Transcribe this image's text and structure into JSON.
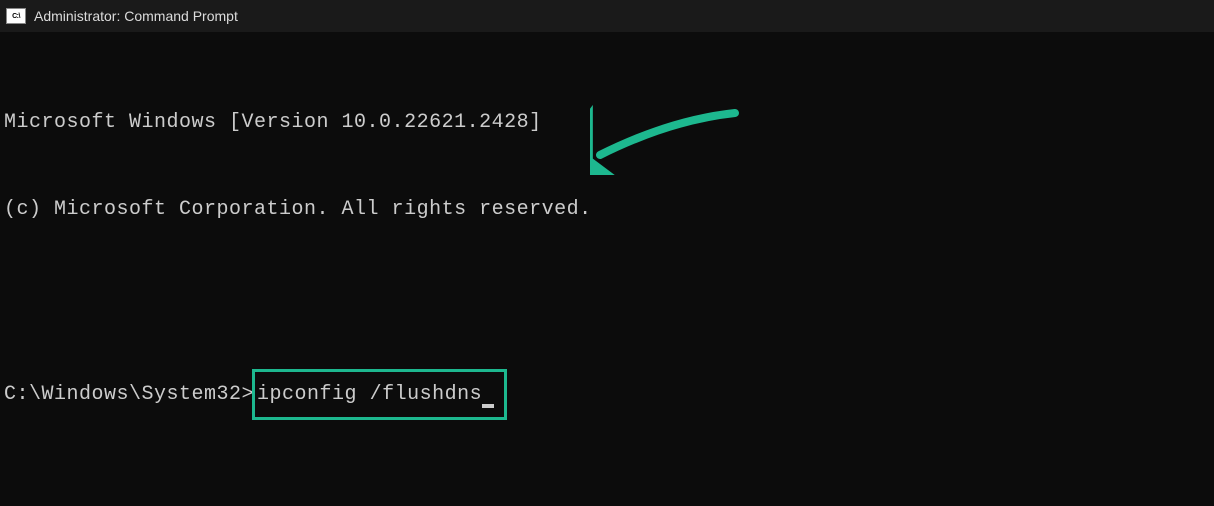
{
  "window": {
    "title": "Administrator: Command Prompt"
  },
  "terminal": {
    "line1": "Microsoft Windows [Version 10.0.22621.2428]",
    "line2": "(c) Microsoft Corporation. All rights reserved.",
    "prompt": "C:\\Windows\\System32>",
    "command": "ipconfig /flushdns"
  },
  "annotation": {
    "highlight_color": "#1db88f",
    "arrow_color": "#1db88f"
  }
}
